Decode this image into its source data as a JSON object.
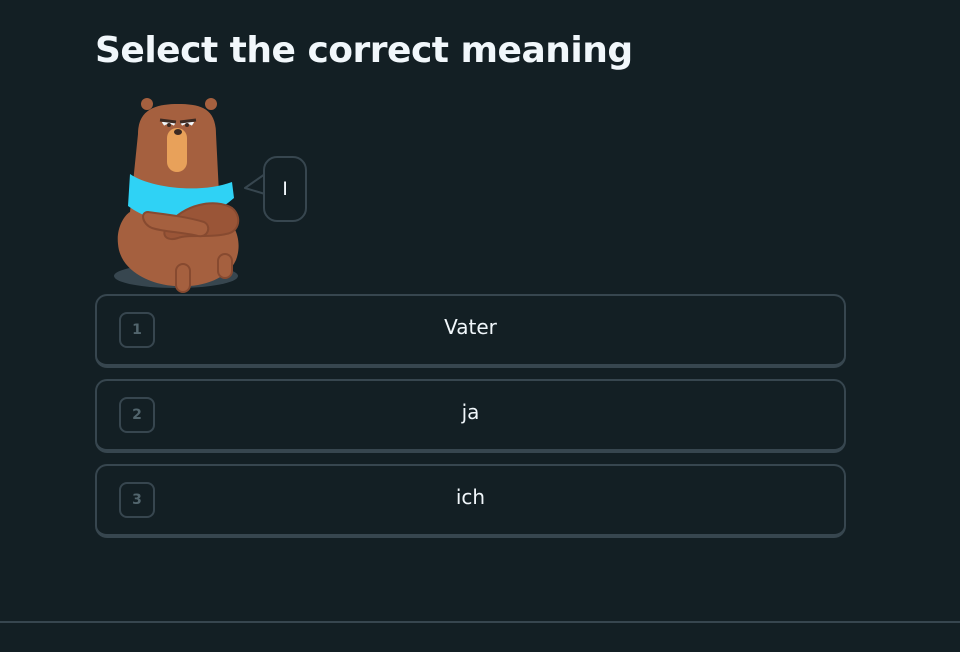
{
  "challenge": {
    "title": "Select the correct meaning",
    "prompt_word": "I"
  },
  "character": {
    "name": "bear-character",
    "colors": {
      "fur": "#a5603f",
      "muzzle": "#e8a15a",
      "scarf": "#2fd2f5"
    }
  },
  "options": [
    {
      "number": "1",
      "text": "Vater"
    },
    {
      "number": "2",
      "text": "ja"
    },
    {
      "number": "3",
      "text": "ich"
    }
  ],
  "colors": {
    "background": "#131f24",
    "border": "#37464f",
    "text": "#f1f7fb",
    "muted": "#52656d"
  }
}
